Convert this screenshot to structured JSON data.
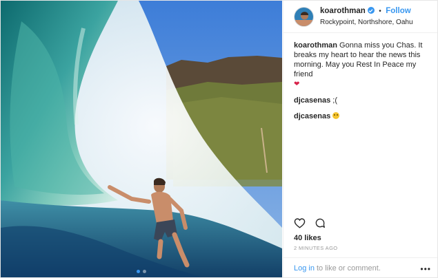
{
  "post": {
    "username": "koarothman",
    "verified": true,
    "separator": "•",
    "follow_label": "Follow",
    "location": "Rockypoint, Northshore, Oahu",
    "caption_user": "koarothman",
    "caption_text": "Gonna miss you Chas. It breaks my heart to hear the news this morning. May you Rest In Peace my friend",
    "caption_emoji": "❤",
    "comments": [
      {
        "user": "djcasenas",
        "text": ";("
      },
      {
        "user": "djcasenas",
        "emoji": "sad-face-emoji"
      }
    ],
    "likes": "40 likes",
    "timestamp": "2 MINUTES AGO"
  },
  "footer": {
    "login_label": "Log in",
    "suffix_text": "to like or comment.",
    "more_label": "•••"
  },
  "carousel": {
    "count": 2,
    "active": 0
  },
  "icons": {
    "verified": "verified-badge-icon",
    "like": "heart-outline-icon",
    "comment": "speech-bubble-icon",
    "more": "more-options-icon"
  },
  "colors": {
    "accent": "#3897f0",
    "muted": "#999999",
    "text": "#262626",
    "heart": "#d8234b"
  }
}
